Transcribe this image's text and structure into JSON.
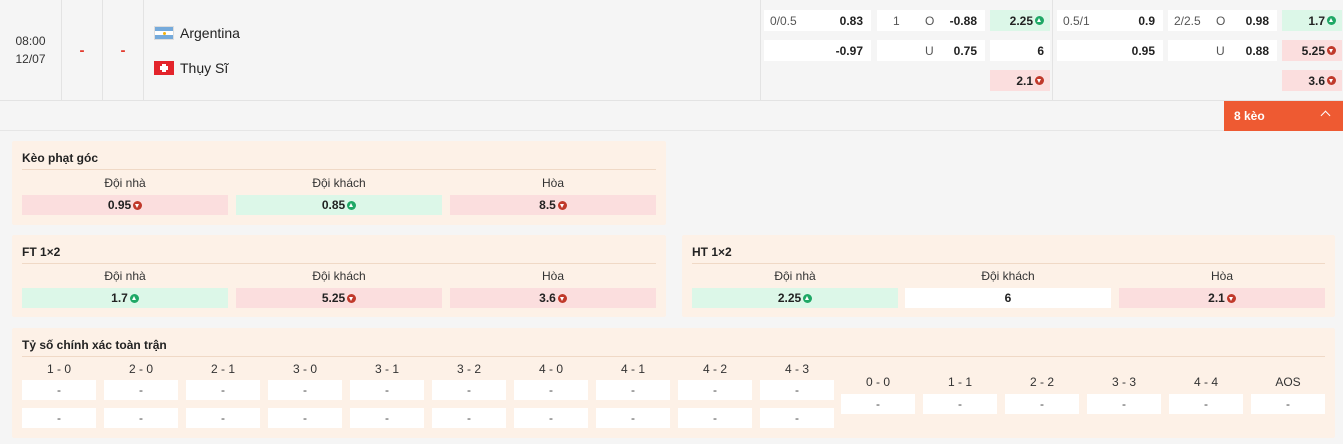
{
  "match": {
    "time": "08:00",
    "date": "12/07",
    "home_score": "-",
    "away_score": "-",
    "home_team": "Argentina",
    "away_team": "Thụy Sĩ",
    "home_flag_icon": "argentina-flag-icon",
    "away_flag_icon": "switzerland-flag-icon"
  },
  "odds": {
    "ft_handicap": {
      "line": "0/0.5",
      "home": "0.83",
      "away": "-0.97"
    },
    "ft_over_under": {
      "line": "1",
      "over_label": "O",
      "over": "-0.88",
      "under_label": "U",
      "under": "0.75"
    },
    "ft_1x2": {
      "home": "2.25",
      "home_trend": "up",
      "away": "6",
      "draw": "2.1",
      "draw_trend": "down"
    },
    "ht_handicap": {
      "line": "0.5/1",
      "home": "0.9",
      "away": "0.95"
    },
    "ht_over_under": {
      "line": "2/2.5",
      "over_label": "O",
      "over": "0.98",
      "under_label": "U",
      "under": "0.88"
    },
    "ht_1x2": {
      "home": "1.7",
      "home_trend": "up",
      "away": "5.25",
      "away_trend": "down",
      "draw": "3.6",
      "draw_trend": "down"
    }
  },
  "more_button": {
    "label": "8 kèo",
    "icon": "chevron-up-icon"
  },
  "colors": {
    "accent": "#ee5a32",
    "up": "#1fa866",
    "down": "#c0392b",
    "score": "#e23b2e",
    "panel_bg": "#fdf1e7"
  },
  "corner_panel": {
    "title": "Kèo phạt góc",
    "headers": [
      "Đội nhà",
      "Đội khách",
      "Hòa"
    ],
    "values": [
      "0.95",
      "0.85",
      "8.5"
    ],
    "trends": [
      "down",
      "up",
      "down"
    ]
  },
  "ft_panel": {
    "title": "FT 1×2",
    "headers": [
      "Đội nhà",
      "Đội khách",
      "Hòa"
    ],
    "values": [
      "1.7",
      "5.25",
      "3.6"
    ],
    "trends": [
      "up",
      "down",
      "down"
    ]
  },
  "ht_panel": {
    "title": "HT 1×2",
    "headers": [
      "Đội nhà",
      "Đội khách",
      "Hòa"
    ],
    "values": [
      "2.25",
      "6",
      "2.1"
    ],
    "trends": [
      "up",
      "",
      "down"
    ]
  },
  "correct_score": {
    "title": "Tỷ số chính xác toàn trận",
    "home_win_scores": [
      "1 - 0",
      "2 - 0",
      "2 - 1",
      "3 - 0",
      "3 - 1",
      "3 - 2",
      "4 - 0",
      "4 - 1",
      "4 - 2",
      "4 - 3"
    ],
    "home_win_row1": [
      "-",
      "-",
      "-",
      "-",
      "-",
      "-",
      "-",
      "-",
      "-",
      "-"
    ],
    "home_win_row2": [
      "-",
      "-",
      "-",
      "-",
      "-",
      "-",
      "-",
      "-",
      "-",
      "-"
    ],
    "draw_scores": [
      "0 - 0",
      "1 - 1",
      "2 - 2",
      "3 - 3",
      "4 - 4",
      "AOS"
    ],
    "draw_values": [
      "-",
      "-",
      "-",
      "-",
      "-",
      "-"
    ]
  }
}
